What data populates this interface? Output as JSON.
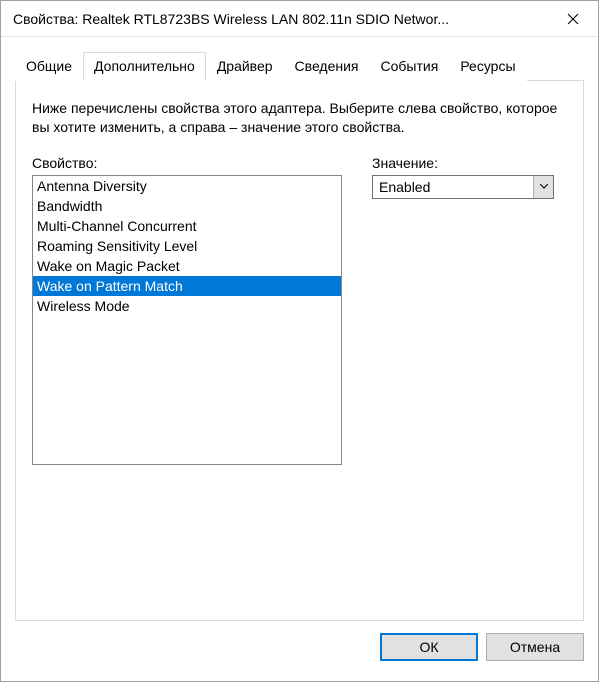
{
  "window": {
    "title": "Свойства: Realtek RTL8723BS Wireless LAN 802.11n SDIO Networ..."
  },
  "tabs": [
    "Общие",
    "Дополнительно",
    "Драйвер",
    "Сведения",
    "События",
    "Ресурсы"
  ],
  "active_tab_index": 1,
  "advanced": {
    "description": "Ниже перечислены свойства этого адаптера. Выберите слева свойство, которое вы хотите изменить, а справа – значение этого свойства.",
    "property_label": "Свойство:",
    "value_label": "Значение:",
    "properties": [
      "Antenna Diversity",
      "Bandwidth",
      "Multi-Channel Concurrent",
      "Roaming Sensitivity Level",
      "Wake on Magic Packet",
      "Wake on Pattern Match",
      "Wireless Mode"
    ],
    "selected_property_index": 5,
    "value_selected": "Enabled"
  },
  "buttons": {
    "ok": "ОК",
    "cancel": "Отмена"
  }
}
